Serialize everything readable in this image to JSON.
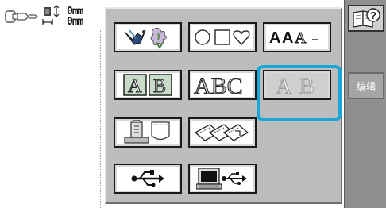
{
  "preview": {
    "height_value": "0mm",
    "width_value": "0mm"
  },
  "main_panel": {
    "buttons": [
      {
        "name": "decorative-patterns",
        "icon": "bird-and-flower-icon"
      },
      {
        "name": "frame-shapes",
        "icon": "circle-square-heart-icon"
      },
      {
        "name": "alphabet-fonts",
        "label": "AAA"
      },
      {
        "name": "framed-monogram",
        "label": "AB"
      },
      {
        "name": "character-stitch",
        "label": "ABC"
      },
      {
        "name": "outline-letters",
        "label": "AB"
      },
      {
        "name": "machine-memory",
        "icon": "machine-and-pocket-icon"
      },
      {
        "name": "embroidery-cards",
        "icon": "embroidery-cards-icon"
      },
      {
        "name": "usb-media",
        "icon": "usb-icon"
      },
      {
        "name": "computer-usb",
        "icon": "computer-usb-icon"
      }
    ]
  },
  "sidebar": {
    "help_icon": "help-book-icon",
    "edit_label": "编辑"
  },
  "colors": {
    "panel_bg": "#bdbdbd",
    "selected_ring": "#1aa6d8",
    "sidebar_bg": "#8f8f8f"
  }
}
